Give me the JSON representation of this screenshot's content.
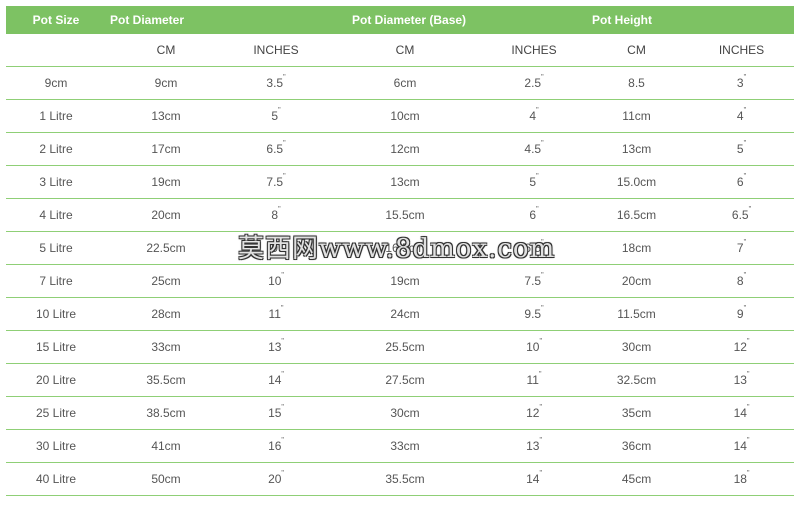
{
  "headers": {
    "pot_size": "Pot Size",
    "pot_diameter": "Pot Diameter",
    "pot_diameter_base": "Pot Diameter (Base)",
    "pot_height": "Pot Height"
  },
  "subheaders": [
    "",
    "CM",
    "INCHES",
    "CM",
    "INCHES",
    "CM",
    "INCHES"
  ],
  "rows": [
    [
      "9cm",
      "9cm",
      "3.5",
      "6cm",
      "2.5",
      "8.5",
      "3"
    ],
    [
      "1 Litre",
      "13cm",
      "5",
      "10cm",
      "4",
      "11cm",
      "4"
    ],
    [
      "2 Litre",
      "17cm",
      "6.5",
      "12cm",
      "4.5",
      "13cm",
      "5"
    ],
    [
      "3 Litre",
      "19cm",
      "7.5",
      "13cm",
      "5",
      "15.0cm",
      "6"
    ],
    [
      "4 Litre",
      "20cm",
      "8",
      "15.5cm",
      "6",
      "16.5cm",
      "6.5"
    ],
    [
      "5 Litre",
      "22.5cm",
      "9",
      "16.5cm",
      "6.5",
      "18cm",
      "7"
    ],
    [
      "7 Litre",
      "25cm",
      "10",
      "19cm",
      "7.5",
      "20cm",
      "8"
    ],
    [
      "10 Litre",
      "28cm",
      "11",
      "24cm",
      "9.5",
      "11.5cm",
      "9"
    ],
    [
      "15 Litre",
      "33cm",
      "13",
      "25.5cm",
      "10",
      "30cm",
      "12"
    ],
    [
      "20 Litre",
      "35.5cm",
      "14",
      "27.5cm",
      "11",
      "32.5cm",
      "13"
    ],
    [
      "25 Litre",
      "38.5cm",
      "15",
      "30cm",
      "12",
      "35cm",
      "14"
    ],
    [
      "30 Litre",
      "41cm",
      "16",
      "33cm",
      "13",
      "36cm",
      "14"
    ],
    [
      "40 Litre",
      "50cm",
      "20",
      "35.5cm",
      "14",
      "45cm",
      "18"
    ]
  ],
  "inch_mark": "\"",
  "watermark": "莫西网www.8dmox.com",
  "colors": {
    "header_bg": "#7dc263",
    "row_border": "#8fcf76",
    "text": "#555555"
  }
}
